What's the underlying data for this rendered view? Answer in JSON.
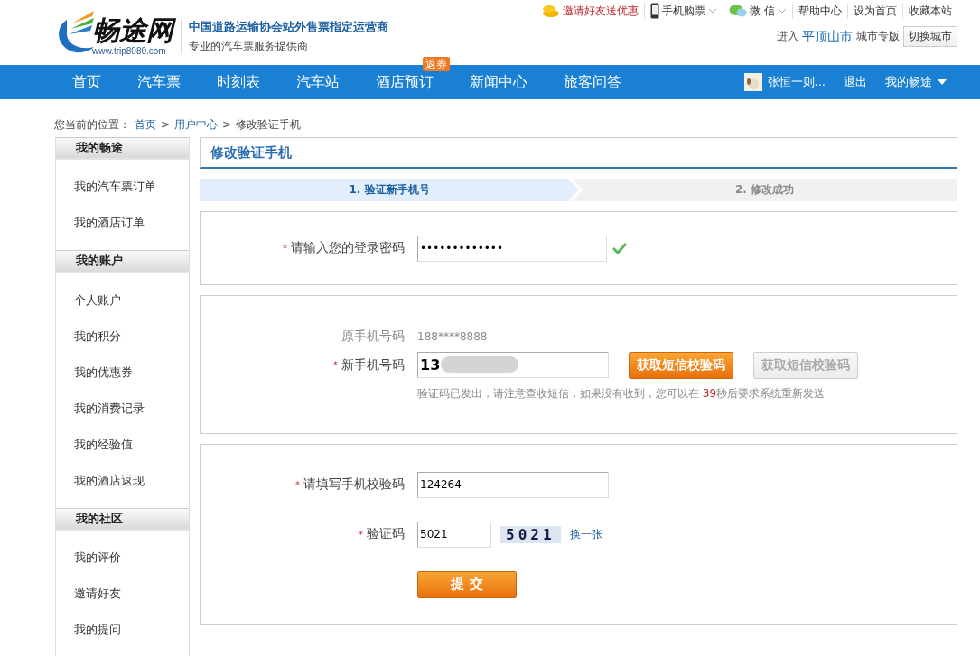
{
  "header": {
    "logo_text": "畅途网",
    "logo_url": "www.trip8080.com",
    "slogan": "中国道路运输协会站外售票指定运营商",
    "subtitle": "专业的汽车票服务提供商",
    "top_links": [
      {
        "kind": "coins",
        "label": "邀请好友送优惠",
        "highlight": true,
        "dropdown": false
      },
      {
        "kind": "phone",
        "label": "手机购票",
        "highlight": false,
        "dropdown": true
      },
      {
        "kind": "wechat",
        "label": "微 信",
        "highlight": false,
        "dropdown": true
      },
      {
        "kind": "plain",
        "label": "帮助中心",
        "highlight": false,
        "dropdown": false
      },
      {
        "kind": "plain",
        "label": "设为首页",
        "highlight": false,
        "dropdown": false
      },
      {
        "kind": "plain",
        "label": "收藏本站",
        "highlight": false,
        "dropdown": false
      }
    ],
    "city": {
      "prefix": "进入",
      "name": "平顶山市",
      "suffix": "城市专版",
      "button": "切换城市"
    }
  },
  "nav": {
    "items": [
      {
        "label": "首页"
      },
      {
        "label": "汽车票"
      },
      {
        "label": "时刻表"
      },
      {
        "label": "汽车站"
      },
      {
        "label": "酒店预订",
        "badge": "返券"
      },
      {
        "label": "新闻中心"
      },
      {
        "label": "旅客问答"
      }
    ],
    "user": "张恒一则...",
    "logout": "退出",
    "my": "我的畅途"
  },
  "breadcrumb": {
    "prefix": "您当前的位置：",
    "links": [
      "首页",
      "用户中心"
    ],
    "current": "修改验证手机",
    "separator": ">"
  },
  "sidebar": [
    {
      "heading": "我的畅途",
      "items": [
        "我的汽车票订单",
        "我的酒店订单"
      ]
    },
    {
      "heading": "我的账户",
      "items": [
        "个人账户",
        "我的积分",
        "我的优惠券",
        "我的消费记录",
        "我的经验值",
        "我的酒店返现"
      ]
    },
    {
      "heading": "我的社区",
      "items": [
        "我的评价",
        "邀请好友",
        "我的提问"
      ]
    }
  ],
  "main": {
    "title": "修改验证手机",
    "steps": [
      {
        "label": "1. 验证新手机号",
        "selected": true
      },
      {
        "label": "2. 修改成功",
        "selected": false
      }
    ],
    "password": {
      "required_mark": "*",
      "label": "请输入您的登录密码",
      "value": "•••••••••••••",
      "valid": true
    },
    "old_phone": {
      "label": "原手机号码",
      "value": "188****8888"
    },
    "new_phone": {
      "required_mark": "*",
      "label": "新手机号码",
      "value": "13",
      "redacted": true
    },
    "sms_buttons": [
      {
        "label": "获取短信校验码",
        "disabled": false
      },
      {
        "label": "获取短信校验码",
        "disabled": true
      }
    ],
    "hint": {
      "before": "验证码已发出，请注意查收短信，如果没有收到，您可以在 ",
      "countdown": "39",
      "after": "秒后要求系统重新发送"
    },
    "sms_code": {
      "required_mark": "*",
      "label": "请填写手机校验码",
      "value": "124264"
    },
    "captcha": {
      "required_mark": "*",
      "label": "验证码",
      "value": "5021",
      "image_text": "5021",
      "refresh": "换一张"
    },
    "submit": "提 交"
  }
}
